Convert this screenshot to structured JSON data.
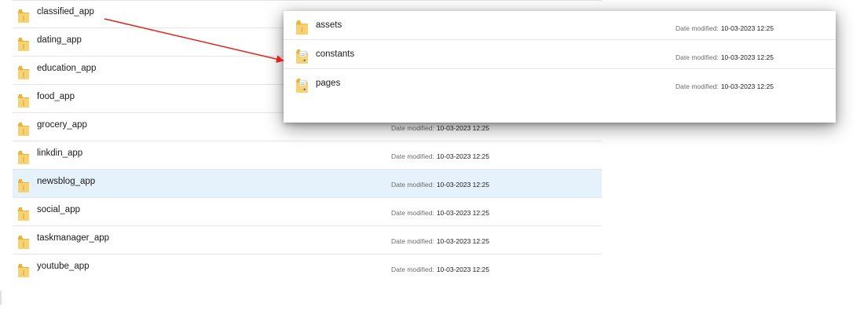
{
  "date_label": "Date modified:",
  "folders": [
    {
      "name": "classified_app",
      "date": "",
      "selected": false
    },
    {
      "name": "dating_app",
      "date": "",
      "selected": false
    },
    {
      "name": "education_app",
      "date": "",
      "selected": false
    },
    {
      "name": "food_app",
      "date": "",
      "selected": false
    },
    {
      "name": "grocery_app",
      "date": "10-03-2023 12:25",
      "selected": false
    },
    {
      "name": "linkdin_app",
      "date": "10-03-2023 12:25",
      "selected": false
    },
    {
      "name": "newsblog_app",
      "date": "10-03-2023 12:25",
      "selected": true
    },
    {
      "name": "social_app",
      "date": "10-03-2023 12:25",
      "selected": false
    },
    {
      "name": "taskmanager_app",
      "date": "10-03-2023 12:25",
      "selected": false
    },
    {
      "name": "youtube_app",
      "date": "10-03-2023 12:25",
      "selected": false
    }
  ],
  "popup_items": [
    {
      "name": "assets",
      "date": "10-03-2023 12:25",
      "icon": "folder-icon"
    },
    {
      "name": "constants",
      "date": "10-03-2023 12:25",
      "icon": "folder-with-document-icon"
    },
    {
      "name": "pages",
      "date": "10-03-2023 12:25",
      "icon": "folder-with-document-icon"
    }
  ],
  "annotation": {
    "color": "#e0241c"
  },
  "colors": {
    "selected_row": "#e5f1fb",
    "folder_yellow": "#f5c84a"
  }
}
